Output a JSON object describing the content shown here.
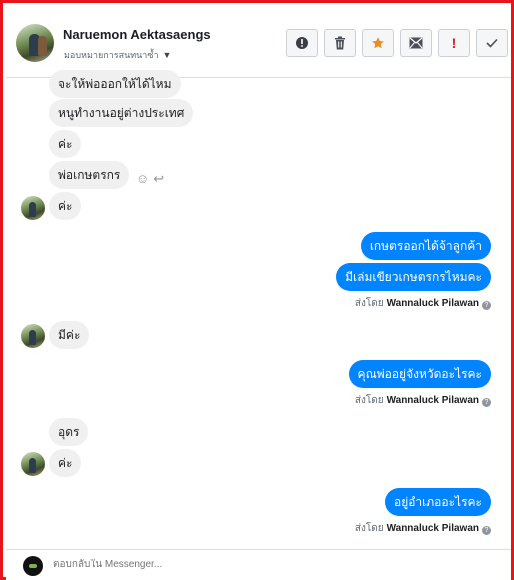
{
  "header": {
    "contact_name": "Naruemon Aektasaengs",
    "assignment": "มอบหมายการสนทนาซ้ำ",
    "actions": [
      {
        "icon": "alert-circle-icon",
        "label": "!"
      },
      {
        "icon": "trash-icon",
        "label": "🗑"
      },
      {
        "icon": "star-icon",
        "label": "★"
      },
      {
        "icon": "envelope-icon",
        "label": "✉"
      },
      {
        "icon": "spam-icon",
        "label": "!"
      },
      {
        "icon": "check-icon",
        "label": "✓"
      }
    ]
  },
  "messages": {
    "m1": "จะให้พ่อออกให้ได้ไหม",
    "m2": "หนูทำงานอยู่ต่างประเทศ",
    "m3": "ค่ะ",
    "m4": "พ่อเกษตรกร",
    "m5": "ค่ะ",
    "m6": "เกษตรออกได้จ้าลูกค้า",
    "m7": "มีเล่มเขียวเกษตรกรไหมคะ",
    "m8": "มีค่ะ",
    "m9": "คุณพ่ออยู่จังหวัดอะไรคะ",
    "m10": "อุดร",
    "m11": "ค่ะ",
    "m12": "อยู่อำเภออะไรคะ"
  },
  "sent_by": {
    "prefix": "ส่งโดย",
    "agent": "Wannaluck Pilawan"
  },
  "composer": {
    "placeholder": "ตอบกลับใน Messenger..."
  }
}
